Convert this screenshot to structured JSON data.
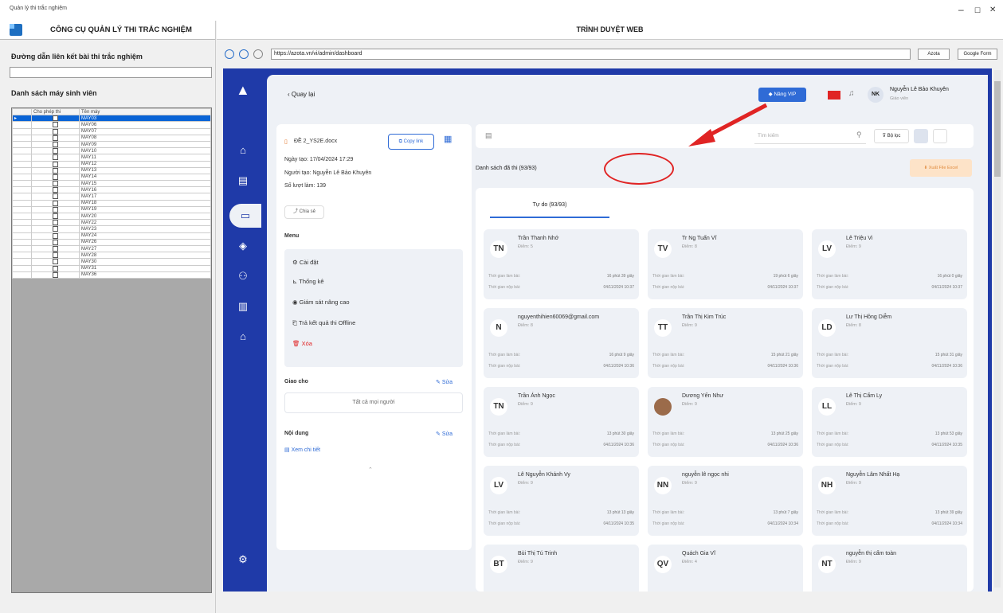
{
  "window": {
    "title": "Quản lý thi trắc nghiệm",
    "controls": [
      "–",
      "☐",
      "✕"
    ]
  },
  "left": {
    "header": "CÔNG CỤ QUẢN LÝ THI TRẮC NGHIỆM",
    "link_label": "Đường dẫn liên kết bài thi trắc nghiệm",
    "link_value": "",
    "list_label": "Danh sách máy sinh viên",
    "col_allow": "Cho phép thi",
    "col_name": "Tên máy",
    "machines": [
      "MAY03",
      "MAY06",
      "MAY07",
      "MAY08",
      "MAY09",
      "MAY10",
      "MAY11",
      "MAY12",
      "MAY13",
      "MAY14",
      "MAY15",
      "MAY16",
      "MAY17",
      "MAY18",
      "MAY19",
      "MAY20",
      "MAY22",
      "MAY23",
      "MAY24",
      "MAY26",
      "MAY27",
      "MAY28",
      "MAY30",
      "MAY31",
      "MAY36"
    ]
  },
  "browser": {
    "header": "TRÌNH DUYỆT WEB",
    "url": "https://azota.vn/vi/admin/dashboard",
    "btn_azota": "Azota",
    "btn_google": "Google Form"
  },
  "app": {
    "back": "Quay lại",
    "vip": "Nâng VIP",
    "user_initials": "NK",
    "user_name": "Nguyễn Lê Bảo Khuyên",
    "user_role": "Giáo viên",
    "file": "ĐỀ 2_YS2E.docx",
    "copy_link": "Copy link",
    "created": "Ngày tạo: 17/04/2024 17:29",
    "author": "Người tạo: Nguyễn Lê Bảo Khuyên",
    "attempts": "Số lượt làm: 139",
    "share": "Chia sẻ",
    "menu_title": "Menu",
    "menu": [
      "Cài đặt",
      "Thống kê",
      "Giám sát nâng cao",
      "Trả kết quả thi Offline",
      "Xóa"
    ],
    "assign_title": "Giao cho",
    "edit": "Sửa",
    "assign_value": "Tất cả mọi người",
    "content_title": "Nội dung",
    "detail": "Xem chi tiết",
    "search_placeholder": "Tìm kiếm",
    "filter": "Bộ lọc",
    "list_title": "Danh sách đã thi (93/93)",
    "export": "Xuất File Excel",
    "tab": "Tự do (93/93)",
    "lbl_time": "Thời gian làm bài:",
    "lbl_submit": "Thời gian nộp bài:",
    "cards": [
      {
        "i": "TN",
        "n": "Trần Thanh Nhớ",
        "s": "Điểm: 5",
        "t": "16 phút 39 giây",
        "d": "04/11/2024 10:37"
      },
      {
        "i": "TV",
        "n": "Tr Ng Tuấn Vĩ",
        "s": "Điểm: 8",
        "t": "19 phút 6 giây",
        "d": "04/11/2024 10:37"
      },
      {
        "i": "LV",
        "n": "Lê Triệu Vi",
        "s": "Điểm: 9",
        "t": "16 phút 0 giây",
        "d": "04/11/2024 10:37"
      },
      {
        "i": "N",
        "n": "nguyenthihien60069@gmail.com",
        "s": "Điểm: 8",
        "t": "16 phút 9 giây",
        "d": "04/11/2024 10:36"
      },
      {
        "i": "TT",
        "n": "Trần Thị Kim Trúc",
        "s": "Điểm: 9",
        "t": "15 phút 21 giây",
        "d": "04/11/2024 10:36"
      },
      {
        "i": "LD",
        "n": "Lư Thị Hồng Diễm",
        "s": "Điểm: 8",
        "t": "15 phút 31 giây",
        "d": "04/11/2024 10:36"
      },
      {
        "i": "TN",
        "n": "Trần Ánh Ngọc",
        "s": "Điểm: 9",
        "t": "13 phút 30 giây",
        "d": "04/11/2024 10:36"
      },
      {
        "i": "",
        "n": "Dương Yến Như",
        "s": "Điểm: 9",
        "t": "13 phút 25 giây",
        "d": "04/11/2024 10:36"
      },
      {
        "i": "LL",
        "n": "Lê Thị Cẩm Ly",
        "s": "Điểm: 9",
        "t": "13 phút 53 giây",
        "d": "04/11/2024 10:35"
      },
      {
        "i": "LV",
        "n": "Lê Nguyễn Khánh Vy",
        "s": "Điểm: 9",
        "t": "13 phút 13 giây",
        "d": "04/11/2024 10:35"
      },
      {
        "i": "NN",
        "n": "nguyễn lê ngọc nhi",
        "s": "Điểm: 9",
        "t": "13 phút 7 giây",
        "d": "04/11/2024 10:34"
      },
      {
        "i": "NH",
        "n": "Nguyễn Lâm Nhất Hạ",
        "s": "Điểm: 9",
        "t": "13 phút 39 giây",
        "d": "04/11/2024 10:34"
      },
      {
        "i": "BT",
        "n": "Bùi Thị Tú Trinh",
        "s": "Điểm: 9",
        "t": "",
        "d": ""
      },
      {
        "i": "QV",
        "n": "Quách Gia Vĩ",
        "s": "Điểm: 4",
        "t": "",
        "d": ""
      },
      {
        "i": "NT",
        "n": "nguyễn thị cẩm toàn",
        "s": "Điểm: 9",
        "t": "",
        "d": ""
      }
    ]
  },
  "colors": {
    "sidebar": "#1f3aa8",
    "accent": "#2f6bd6",
    "danger": "#e02424",
    "selected_row": "#0a64d6"
  }
}
